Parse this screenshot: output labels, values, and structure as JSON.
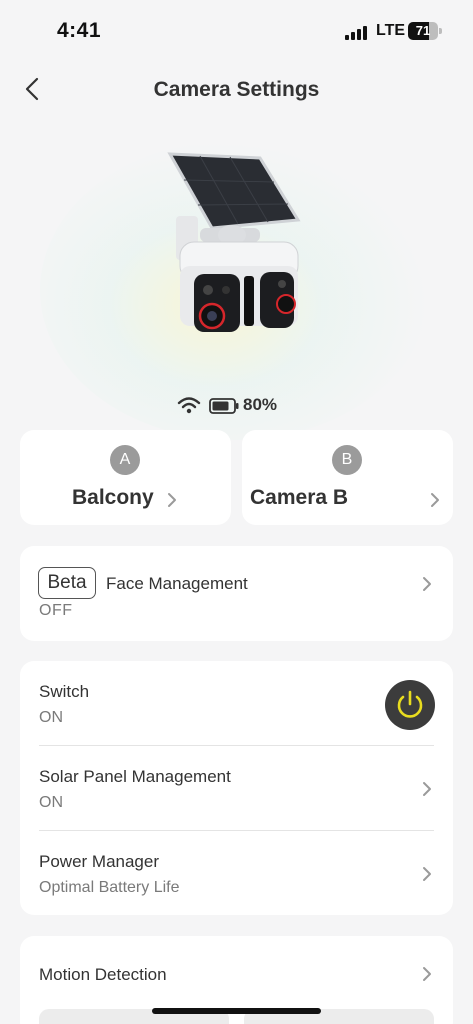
{
  "status_bar": {
    "time": "4:41",
    "network": "LTE",
    "battery_level": "71",
    "battery_fraction": 0.71
  },
  "header": {
    "title": "Camera Settings",
    "back_icon": "chevron-left-icon"
  },
  "device": {
    "image_icon": "solar-camera-image",
    "wifi_icon": "wifi-icon",
    "battery_icon": "battery-icon",
    "battery_percent": "80%"
  },
  "channels": [
    {
      "badge": "A",
      "name": "Balcony"
    },
    {
      "badge": "B",
      "name": "Camera B"
    }
  ],
  "face_management": {
    "tag": "Beta",
    "label": "Face Management",
    "value": "OFF"
  },
  "power_section": {
    "switch": {
      "label": "Switch",
      "value": "ON",
      "icon": "power-icon",
      "accent": "#e8dc1f"
    },
    "solar": {
      "label": "Solar Panel Management",
      "value": "ON"
    },
    "power_manager": {
      "label": "Power Manager",
      "value": "Optimal Battery Life"
    }
  },
  "motion": {
    "label": "Motion Detection"
  },
  "colors": {
    "background": "#f5f5f6",
    "card": "#ffffff",
    "badge": "#9b9b9b",
    "toggle_bg": "#3c3c3c",
    "power_accent": "#e8dc1f"
  }
}
